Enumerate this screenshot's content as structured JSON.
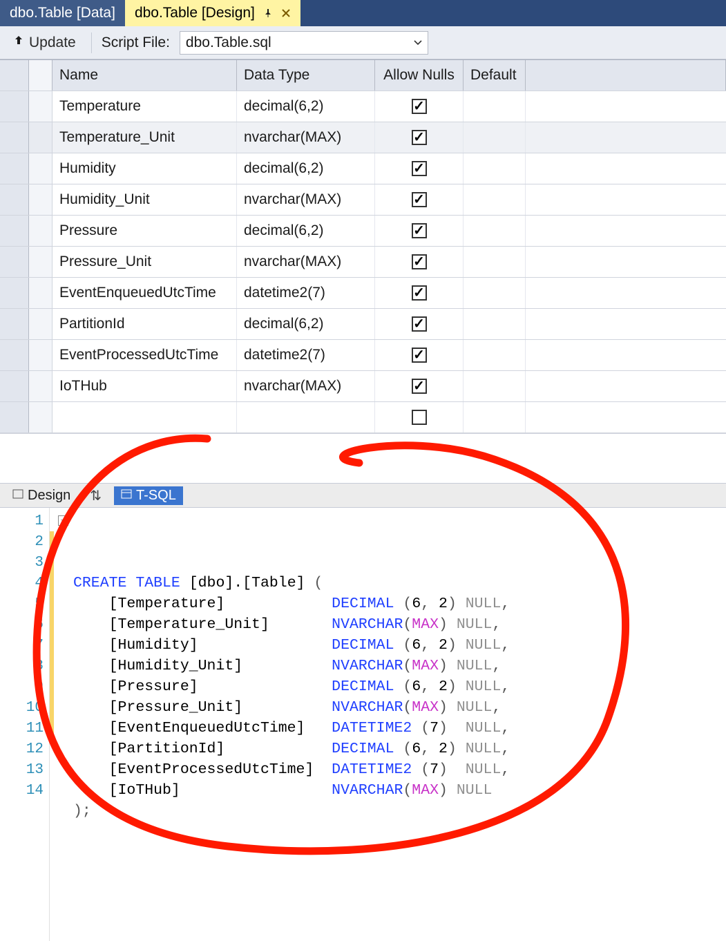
{
  "tabs": {
    "inactive_label": "dbo.Table [Data]",
    "active_label": "dbo.Table [Design]"
  },
  "toolbar": {
    "update_label": "Update",
    "script_file_label": "Script File:",
    "script_file_value": "dbo.Table.sql"
  },
  "grid": {
    "headers": {
      "name": "Name",
      "data_type": "Data Type",
      "allow_nulls": "Allow Nulls",
      "default": "Default"
    },
    "rows": [
      {
        "name": "Temperature",
        "type": "decimal(6,2)",
        "nulls": true,
        "default": "",
        "selected": false
      },
      {
        "name": "Temperature_Unit",
        "type": "nvarchar(MAX)",
        "nulls": true,
        "default": "",
        "selected": true
      },
      {
        "name": "Humidity",
        "type": "decimal(6,2)",
        "nulls": true,
        "default": "",
        "selected": false
      },
      {
        "name": "Humidity_Unit",
        "type": "nvarchar(MAX)",
        "nulls": true,
        "default": "",
        "selected": false
      },
      {
        "name": "Pressure",
        "type": "decimal(6,2)",
        "nulls": true,
        "default": "",
        "selected": false
      },
      {
        "name": "Pressure_Unit",
        "type": "nvarchar(MAX)",
        "nulls": true,
        "default": "",
        "selected": false
      },
      {
        "name": "EventEnqueuedUtcTime",
        "type": "datetime2(7)",
        "nulls": true,
        "default": "",
        "selected": false
      },
      {
        "name": "PartitionId",
        "type": "decimal(6,2)",
        "nulls": true,
        "default": "",
        "selected": false
      },
      {
        "name": "EventProcessedUtcTime",
        "type": "datetime2(7)",
        "nulls": true,
        "default": "",
        "selected": false
      },
      {
        "name": "IoTHub",
        "type": "nvarchar(MAX)",
        "nulls": true,
        "default": "",
        "selected": false
      },
      {
        "name": "",
        "type": "",
        "nulls": false,
        "default": "",
        "selected": false
      }
    ]
  },
  "lower_tabs": {
    "design_label": "Design",
    "tsql_label": "T-SQL"
  },
  "sql": {
    "current_line_index": 8,
    "lines": [
      {
        "n": 1,
        "mod": false,
        "tokens": [
          {
            "c": "kw",
            "t": "CREATE"
          },
          {
            "c": "plain",
            "t": " "
          },
          {
            "c": "kw",
            "t": "TABLE"
          },
          {
            "c": "plain",
            "t": " ["
          },
          {
            "c": "plain",
            "t": "dbo"
          },
          {
            "c": "plain",
            "t": "].["
          },
          {
            "c": "plain",
            "t": "Table"
          },
          {
            "c": "plain",
            "t": "] "
          },
          {
            "c": "paren",
            "t": "("
          }
        ]
      },
      {
        "n": 2,
        "mod": true,
        "tokens": [
          {
            "c": "plain",
            "t": "    [Temperature]            "
          },
          {
            "c": "type",
            "t": "DECIMAL"
          },
          {
            "c": "plain",
            "t": " "
          },
          {
            "c": "paren",
            "t": "("
          },
          {
            "c": "num",
            "t": "6"
          },
          {
            "c": "punc",
            "t": ","
          },
          {
            "c": "plain",
            "t": " "
          },
          {
            "c": "num",
            "t": "2"
          },
          {
            "c": "paren",
            "t": ")"
          },
          {
            "c": "plain",
            "t": " "
          },
          {
            "c": "null",
            "t": "NULL"
          },
          {
            "c": "punc",
            "t": ","
          }
        ]
      },
      {
        "n": 3,
        "mod": true,
        "tokens": [
          {
            "c": "plain",
            "t": "    [Temperature_Unit]       "
          },
          {
            "c": "type",
            "t": "NVARCHAR"
          },
          {
            "c": "paren",
            "t": "("
          },
          {
            "c": "max",
            "t": "MAX"
          },
          {
            "c": "paren",
            "t": ")"
          },
          {
            "c": "plain",
            "t": " "
          },
          {
            "c": "null",
            "t": "NULL"
          },
          {
            "c": "punc",
            "t": ","
          }
        ]
      },
      {
        "n": 4,
        "mod": true,
        "tokens": [
          {
            "c": "plain",
            "t": "    [Humidity]               "
          },
          {
            "c": "type",
            "t": "DECIMAL"
          },
          {
            "c": "plain",
            "t": " "
          },
          {
            "c": "paren",
            "t": "("
          },
          {
            "c": "num",
            "t": "6"
          },
          {
            "c": "punc",
            "t": ","
          },
          {
            "c": "plain",
            "t": " "
          },
          {
            "c": "num",
            "t": "2"
          },
          {
            "c": "paren",
            "t": ")"
          },
          {
            "c": "plain",
            "t": " "
          },
          {
            "c": "null",
            "t": "NULL"
          },
          {
            "c": "punc",
            "t": ","
          }
        ]
      },
      {
        "n": 5,
        "mod": true,
        "tokens": [
          {
            "c": "plain",
            "t": "    [Humidity_Unit]          "
          },
          {
            "c": "type",
            "t": "NVARCHAR"
          },
          {
            "c": "paren",
            "t": "("
          },
          {
            "c": "max",
            "t": "MAX"
          },
          {
            "c": "paren",
            "t": ")"
          },
          {
            "c": "plain",
            "t": " "
          },
          {
            "c": "null",
            "t": "NULL"
          },
          {
            "c": "punc",
            "t": ","
          }
        ]
      },
      {
        "n": 6,
        "mod": true,
        "tokens": [
          {
            "c": "plain",
            "t": "    [Pressure]               "
          },
          {
            "c": "type",
            "t": "DECIMAL"
          },
          {
            "c": "plain",
            "t": " "
          },
          {
            "c": "paren",
            "t": "("
          },
          {
            "c": "num",
            "t": "6"
          },
          {
            "c": "punc",
            "t": ","
          },
          {
            "c": "plain",
            "t": " "
          },
          {
            "c": "num",
            "t": "2"
          },
          {
            "c": "paren",
            "t": ")"
          },
          {
            "c": "plain",
            "t": " "
          },
          {
            "c": "null",
            "t": "NULL"
          },
          {
            "c": "punc",
            "t": ","
          }
        ]
      },
      {
        "n": 7,
        "mod": true,
        "tokens": [
          {
            "c": "plain",
            "t": "    [Pressure_Unit]          "
          },
          {
            "c": "type",
            "t": "NVARCHAR"
          },
          {
            "c": "paren",
            "t": "("
          },
          {
            "c": "max",
            "t": "MAX"
          },
          {
            "c": "paren",
            "t": ")"
          },
          {
            "c": "plain",
            "t": " "
          },
          {
            "c": "null",
            "t": "NULL"
          },
          {
            "c": "punc",
            "t": ","
          }
        ]
      },
      {
        "n": 8,
        "mod": true,
        "tokens": [
          {
            "c": "plain",
            "t": "    [EventEnqueuedUtcTime]   "
          },
          {
            "c": "type",
            "t": "DATETIME2"
          },
          {
            "c": "plain",
            "t": " "
          },
          {
            "c": "paren",
            "t": "("
          },
          {
            "c": "num",
            "t": "7"
          },
          {
            "c": "paren",
            "t": ")"
          },
          {
            "c": "plain",
            "t": "  "
          },
          {
            "c": "null",
            "t": "NULL"
          },
          {
            "c": "punc",
            "t": ","
          }
        ]
      },
      {
        "n": 9,
        "mod": true,
        "tokens": [
          {
            "c": "plain",
            "t": "    [PartitionId]            "
          },
          {
            "c": "type",
            "t": "DECIMAL"
          },
          {
            "c": "plain",
            "t": " "
          },
          {
            "c": "paren",
            "t": "("
          },
          {
            "c": "num",
            "t": "6"
          },
          {
            "c": "punc",
            "t": ","
          },
          {
            "c": "plain",
            "t": " "
          },
          {
            "c": "num",
            "t": "2"
          },
          {
            "c": "paren",
            "t": ")"
          },
          {
            "c": "plain",
            "t": " "
          },
          {
            "c": "null",
            "t": "NULL"
          },
          {
            "c": "punc",
            "t": ","
          }
        ]
      },
      {
        "n": 10,
        "mod": true,
        "tokens": [
          {
            "c": "plain",
            "t": "    [EventProcessedUtcTime]  "
          },
          {
            "c": "type",
            "t": "DATETIME2"
          },
          {
            "c": "plain",
            "t": " "
          },
          {
            "c": "paren",
            "t": "("
          },
          {
            "c": "num",
            "t": "7"
          },
          {
            "c": "paren",
            "t": ")"
          },
          {
            "c": "plain",
            "t": "  "
          },
          {
            "c": "null",
            "t": "NULL"
          },
          {
            "c": "punc",
            "t": ","
          }
        ]
      },
      {
        "n": 11,
        "mod": true,
        "tokens": [
          {
            "c": "plain",
            "t": "    [IoTHub]                 "
          },
          {
            "c": "type",
            "t": "NVARCHAR"
          },
          {
            "c": "paren",
            "t": "("
          },
          {
            "c": "max",
            "t": "MAX"
          },
          {
            "c": "paren",
            "t": ")"
          },
          {
            "c": "plain",
            "t": " "
          },
          {
            "c": "null",
            "t": "NULL"
          }
        ]
      },
      {
        "n": 12,
        "mod": false,
        "tokens": [
          {
            "c": "paren",
            "t": ")"
          },
          {
            "c": "punc",
            "t": ";"
          }
        ]
      },
      {
        "n": 13,
        "mod": false,
        "tokens": []
      },
      {
        "n": 14,
        "mod": false,
        "tokens": []
      }
    ]
  }
}
